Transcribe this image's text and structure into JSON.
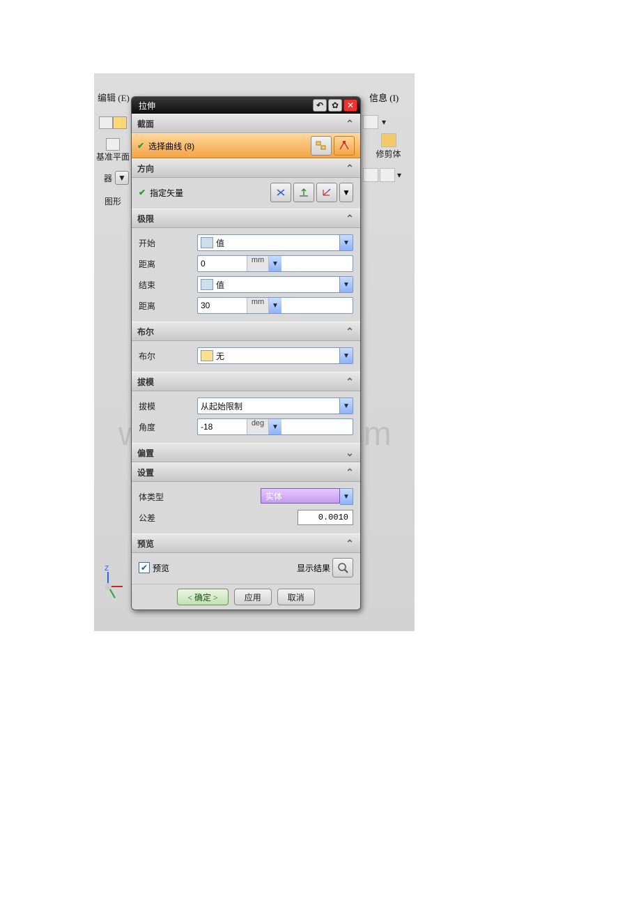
{
  "menu": {
    "edit": "编辑 (E)",
    "info": "信息 (I)"
  },
  "sidebar": {
    "datum": "基准平面",
    "filter_suffix": "器",
    "sketch": "图形"
  },
  "right": {
    "trim": "修剪体"
  },
  "dialog": {
    "title": "拉伸",
    "sections": {
      "section": "截面",
      "select_curve": "选择曲线 (8)",
      "direction": "方向",
      "specify_vector": "指定矢量",
      "limits": "极限",
      "start": "开始",
      "distance1": "距离",
      "end": "结束",
      "distance2": "距离",
      "boolean_hdr": "布尔",
      "boolean": "布尔",
      "draft_hdr": "拔模",
      "draft": "拔模",
      "angle": "角度",
      "offset": "偏置",
      "settings": "设置",
      "body_type": "体类型",
      "tolerance": "公差",
      "preview_hdr": "预览",
      "preview": "预览",
      "show_result": "显示结果"
    },
    "values": {
      "start_type": "值",
      "start_dist": "0",
      "end_type": "值",
      "end_dist": "30",
      "unit": "mm",
      "boolean": "无",
      "draft_type": "从起始限制",
      "angle": "-18",
      "angle_unit": "deg",
      "body_type": "实体",
      "tolerance": "0.0010"
    },
    "buttons": {
      "ok": "< 确定 >",
      "apply": "应用",
      "cancel": "取消"
    }
  },
  "watermark": "www.wcdocx.com"
}
